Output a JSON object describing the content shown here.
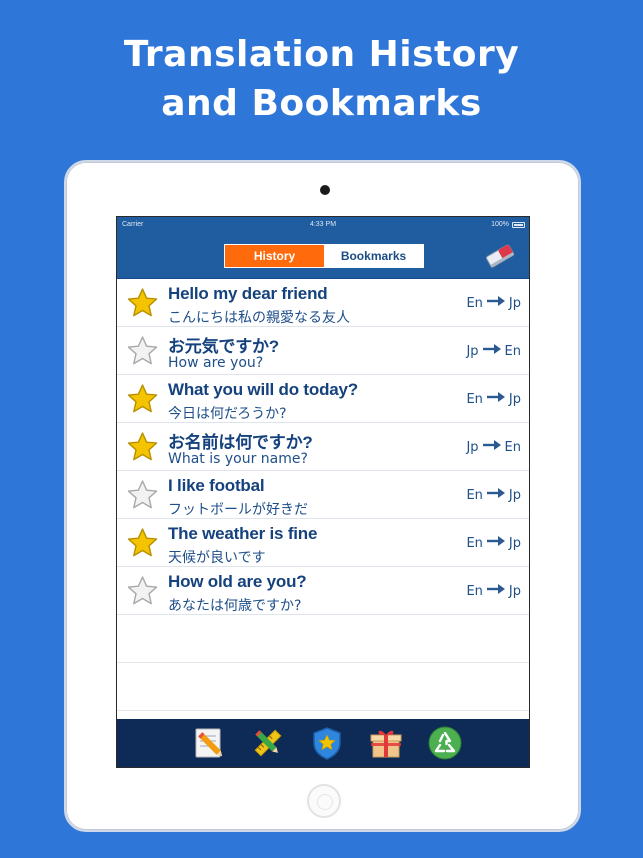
{
  "headline": {
    "line1": "Translation History",
    "line2": "and Bookmarks"
  },
  "status_bar": {
    "carrier": "Carrier",
    "time": "4:33 PM",
    "battery": "100%"
  },
  "segments": {
    "history": "History",
    "bookmarks": "Bookmarks",
    "selected": "History"
  },
  "arrow_icon": "right-arrow-icon",
  "history": [
    {
      "primary": "Hello my dear friend",
      "secondary": "こんにちは私の親愛なる友人",
      "from": "En",
      "to": "Jp",
      "bookmarked": true
    },
    {
      "primary": "お元気ですか?",
      "secondary": "How are you?",
      "from": "Jp",
      "to": "En",
      "bookmarked": false
    },
    {
      "primary": "What you will do today?",
      "secondary": "今日は何だろうか?",
      "from": "En",
      "to": "Jp",
      "bookmarked": true
    },
    {
      "primary": "お名前は何ですか?",
      "secondary": "What is your name?",
      "from": "Jp",
      "to": "En",
      "bookmarked": true
    },
    {
      "primary": "I like footbal",
      "secondary": "フットボールが好きだ",
      "from": "En",
      "to": "Jp",
      "bookmarked": false
    },
    {
      "primary": "The weather is fine",
      "secondary": "天候が良いです",
      "from": "En",
      "to": "Jp",
      "bookmarked": true
    },
    {
      "primary": "How old are you?",
      "secondary": "あなたは何歳ですか?",
      "from": "En",
      "to": "Jp",
      "bookmarked": false
    }
  ],
  "tab_icons": [
    "notepad-pencil-icon",
    "pencil-ruler-icon",
    "star-shield-icon",
    "gift-box-icon",
    "recycle-icon"
  ],
  "colors": {
    "background": "#2f76d9",
    "nav": "#1f5da0",
    "accent": "#ff6a0d",
    "text": "#15427e",
    "tabbar": "#0e2b58",
    "star_active": "#f5c400"
  }
}
